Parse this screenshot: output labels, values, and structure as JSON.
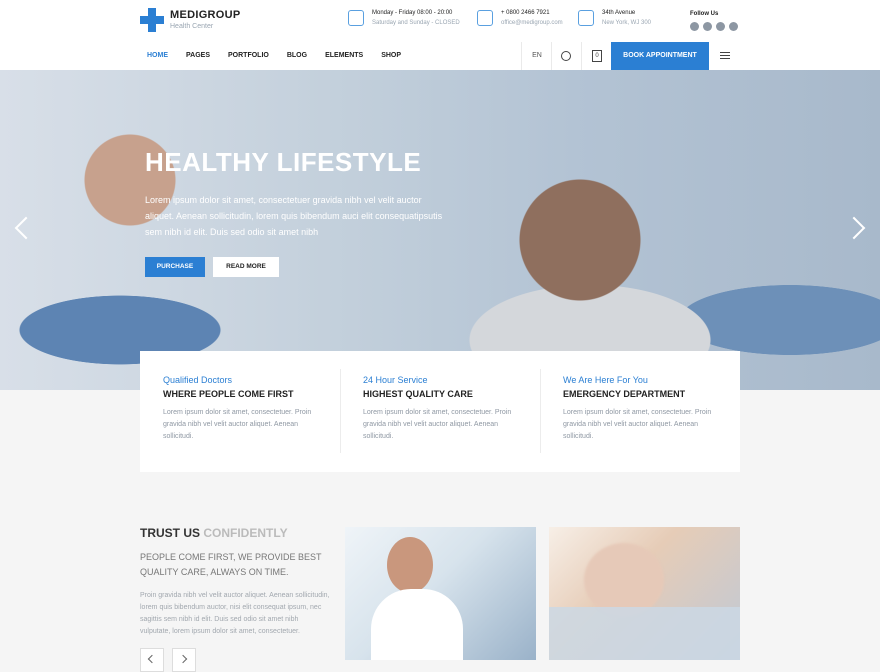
{
  "brand": {
    "name": "MEDIGROUP",
    "tagline": "Health Center"
  },
  "header_info": [
    {
      "icon": "hours-icon",
      "line1": "Monday - Friday 08:00 - 20:00",
      "line2": "Saturday and Sunday - CLOSED"
    },
    {
      "icon": "phone-icon",
      "line1": "+ 0800 2466 7921",
      "line2": "office@medigroup.com"
    },
    {
      "icon": "location-icon",
      "line1": "34th Avenue",
      "line2": "New York, WJ 300"
    }
  ],
  "follow": {
    "label": "Follow Us",
    "icons": [
      "facebook-icon",
      "twitter-icon",
      "linkedin-icon",
      "instagram-icon"
    ]
  },
  "nav": {
    "items": [
      "HOME",
      "PAGES",
      "PORTFOLIO",
      "BLOG",
      "ELEMENTS",
      "SHOP"
    ],
    "language": "EN",
    "cart_count": "0",
    "cta": "BOOK APPOINTMENT"
  },
  "hero": {
    "title": "HEALTHY LIFESTYLE",
    "text": "Lorem ipsum dolor sit amet, consectetuer gravida nibh vel velit auctor aliquet. Aenean sollicitudin, lorem quis bibendum auci elit consequatipsutis sem nibh id elit. Duis sed odio sit amet nibh",
    "primary_button": "PURCHASE",
    "secondary_button": "READ MORE"
  },
  "features": [
    {
      "kicker": "Qualified Doctors",
      "title": "WHERE PEOPLE COME FIRST",
      "body": "Lorem ipsum dolor sit amet, consectetuer. Proin gravida nibh vel velit auctor aliquet. Aenean sollicitudi."
    },
    {
      "kicker": "24 Hour Service",
      "title": "HIGHEST QUALITY CARE",
      "body": "Lorem ipsum dolor sit amet, consectetuer. Proin gravida nibh vel velit auctor aliquet. Aenean sollicitudi."
    },
    {
      "kicker": "We Are Here For You",
      "title": "EMERGENCY DEPARTMENT",
      "body": "Lorem ipsum dolor sit amet, consectetuer. Proin gravida nibh vel velit auctor aliquet. Aenean sollicitudi."
    }
  ],
  "trust": {
    "title_main": "TRUST US",
    "title_ghost": "CONFIDENTLY",
    "subtitle": "PEOPLE COME FIRST, WE PROVIDE BEST QUALITY CARE, ALWAYS ON TIME.",
    "body": "Proin gravida nibh vel velit auctor aliquet. Aenean sollicitudin, lorem quis bibendum auctor, nisi elit consequat ipsum, nec sagittis sem nibh id elit. Duis sed odio sit amet nibh vulputate, lorem ipsum dolor sit amet, consectetuer."
  },
  "colors": {
    "accent": "#2b7fd3",
    "text_dark": "#222222",
    "text_muted": "#8f98a3"
  }
}
